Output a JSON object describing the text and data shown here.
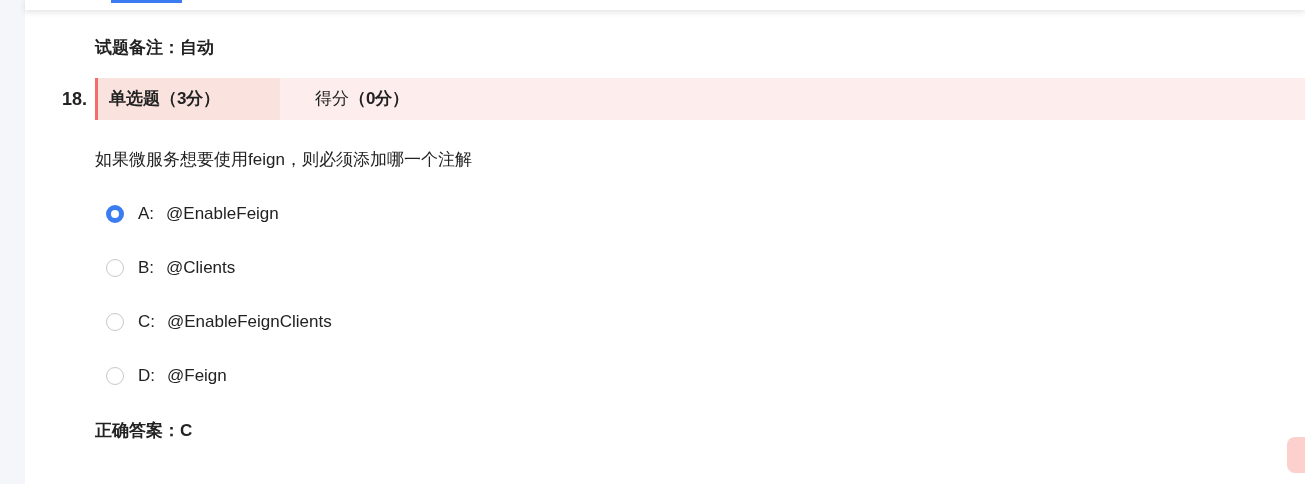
{
  "note": "试题备注：自动",
  "question": {
    "number": "18.",
    "type": "单选题（3分）",
    "score": "得分**（0分）**",
    "text": "如果微服务想要使用feign，则必须添加哪一个注解",
    "options": [
      {
        "letter": "A:",
        "text": "@EnableFeign",
        "selected": true
      },
      {
        "letter": "B:",
        "text": "@Clients",
        "selected": false
      },
      {
        "letter": "C:",
        "text": "@EnableFeignClients",
        "selected": false
      },
      {
        "letter": "D:",
        "text": "@Feign",
        "selected": false
      }
    ],
    "answer": "正确答案：C"
  }
}
